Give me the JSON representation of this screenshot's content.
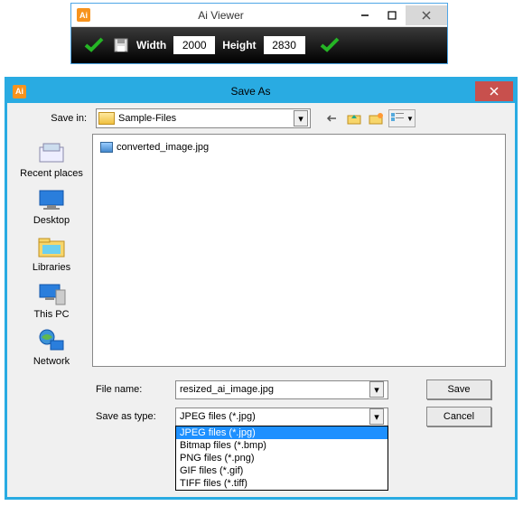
{
  "viewer": {
    "title": "Ai Viewer",
    "width_label": "Width",
    "width_value": "2000",
    "height_label": "Height",
    "height_value": "2830"
  },
  "saveas": {
    "title": "Save As",
    "savein_label": "Save in:",
    "savein_value": "Sample-Files",
    "file_list": [
      {
        "name": "converted_image.jpg"
      }
    ],
    "places": [
      {
        "key": "recent",
        "label": "Recent places"
      },
      {
        "key": "desktop",
        "label": "Desktop"
      },
      {
        "key": "libraries",
        "label": "Libraries"
      },
      {
        "key": "thispc",
        "label": "This PC"
      },
      {
        "key": "network",
        "label": "Network"
      }
    ],
    "filename_label": "File name:",
    "filename_value": "resized_ai_image.jpg",
    "savetype_label": "Save as type:",
    "savetype_value": "JPEG files (*.jpg)",
    "save_button": "Save",
    "cancel_button": "Cancel",
    "type_options": [
      "JPEG files (*.jpg)",
      "Bitmap files (*.bmp)",
      "PNG files (*.png)",
      "GIF files (*.gif)",
      "TIFF files (*.tiff)"
    ],
    "type_selected_index": 0
  }
}
